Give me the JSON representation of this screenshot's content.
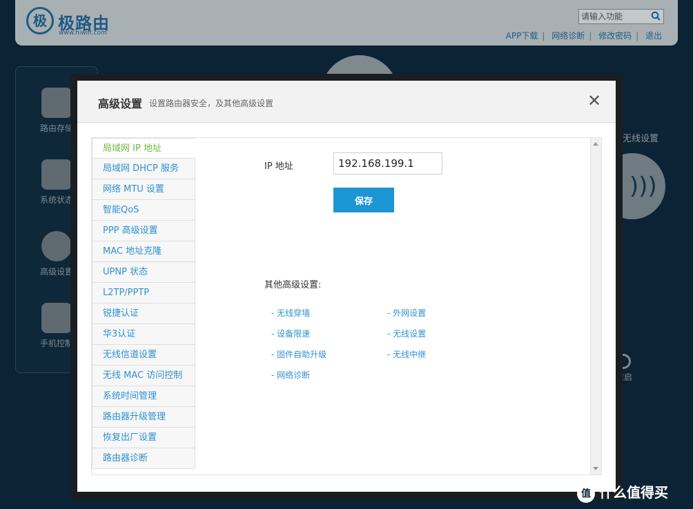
{
  "background": {
    "brand": "极路由",
    "brand_url": "www.hiwifi.com",
    "search_placeholder": "请输入功能",
    "top_links": [
      "APP下载",
      "网络诊断",
      "修改密码",
      "退出"
    ],
    "side_items": [
      "路由存储",
      "系统状态",
      "高级设置",
      "手机控制"
    ],
    "badge": "!",
    "right_label": "无线设置",
    "power_label": "重启"
  },
  "modal": {
    "title": "高级设置",
    "subtitle": "设置路由器安全，及其他高级设置",
    "close_label": "✕",
    "nav_items": [
      "局域网 IP 地址",
      "局域网 DHCP 服务",
      "网络 MTU 设置",
      "智能QoS",
      "PPP 高级设置",
      "MAC 地址克隆",
      "UPNP 状态",
      "L2TP/PPTP",
      "锐捷认证",
      "华3认证",
      "无线信道设置",
      "无线 MAC 访问控制",
      "系统时间管理",
      "路由器升级管理",
      "恢复出厂设置",
      "路由器诊断"
    ],
    "active_nav": 0,
    "ip_label": "IP 地址",
    "ip_value": "192.168.199.1",
    "save_label": "保存",
    "other_title": "其他高级设置:",
    "other_links": [
      "- 无线穿墙",
      "- 外网设置",
      "- 设备限速",
      "- 无线设置",
      "- 固件自助升级",
      "- 无线中继",
      "- 网络诊断"
    ]
  },
  "watermark": {
    "badge": "值",
    "text": "什么值得买"
  },
  "colors": {
    "accent": "#1c95d4",
    "link": "#2e91d2",
    "active": "#6fba3b"
  }
}
